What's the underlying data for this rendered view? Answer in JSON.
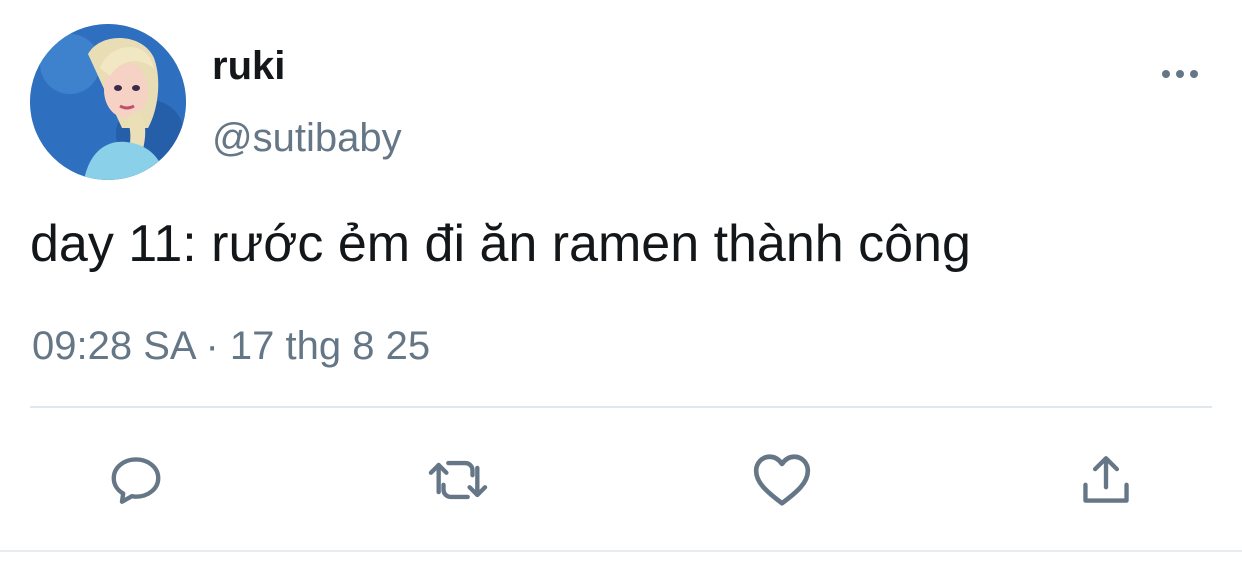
{
  "tweet": {
    "author": {
      "display_name": "ruki",
      "handle": "@sutibaby",
      "avatar": "avatar-icon"
    },
    "text": "day 11: rước ẻm đi ăn ramen thành công",
    "timestamp": "09:28 SA · 17 thg 8 25"
  },
  "actions": [
    {
      "name": "reply",
      "icon": "reply-icon"
    },
    {
      "name": "retweet",
      "icon": "retweet-icon"
    },
    {
      "name": "like",
      "icon": "heart-icon"
    },
    {
      "name": "share",
      "icon": "share-icon"
    }
  ],
  "colors": {
    "text": "#14171a",
    "secondary": "#657786",
    "divider": "#e1e8ed"
  }
}
